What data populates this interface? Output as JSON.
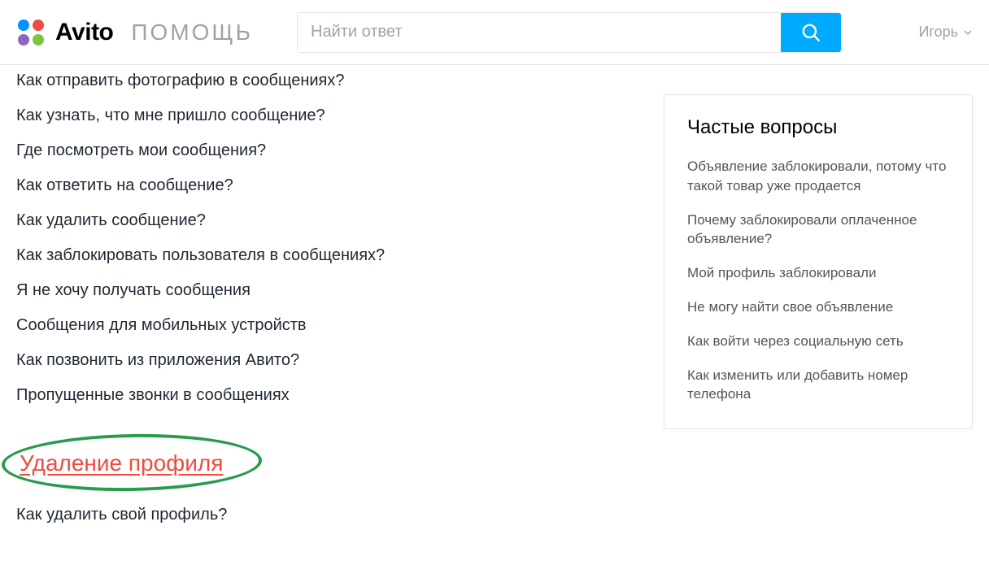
{
  "header": {
    "brand": "Avito",
    "help_label": "помощь",
    "search_placeholder": "Найти ответ",
    "user_name": "Игорь"
  },
  "faq": {
    "items": [
      "Как отправить фотографию в сообщениях?",
      "Как узнать, что мне пришло сообщение?",
      "Где посмотреть мои сообщения?",
      "Как ответить на сообщение?",
      "Как удалить сообщение?",
      "Как заблокировать пользователя в сообщениях?",
      "Я не хочу получать сообщения",
      "Сообщения для мобильных устройств",
      "Как позвонить из приложения Авито?",
      "Пропущенные звонки в сообщениях"
    ]
  },
  "section": {
    "heading": "Удаление профиля",
    "items": [
      "Как удалить свой профиль?"
    ]
  },
  "sidebar": {
    "title": "Частые вопросы",
    "items": [
      "Объявление заблокировали, потому что такой товар уже продается",
      "Почему заблокировали оплаченное объявление?",
      "Мой профиль заблокировали",
      "Не могу найти свое объявление",
      "Как войти через социальную сеть",
      "Как изменить или добавить номер телефона"
    ]
  }
}
